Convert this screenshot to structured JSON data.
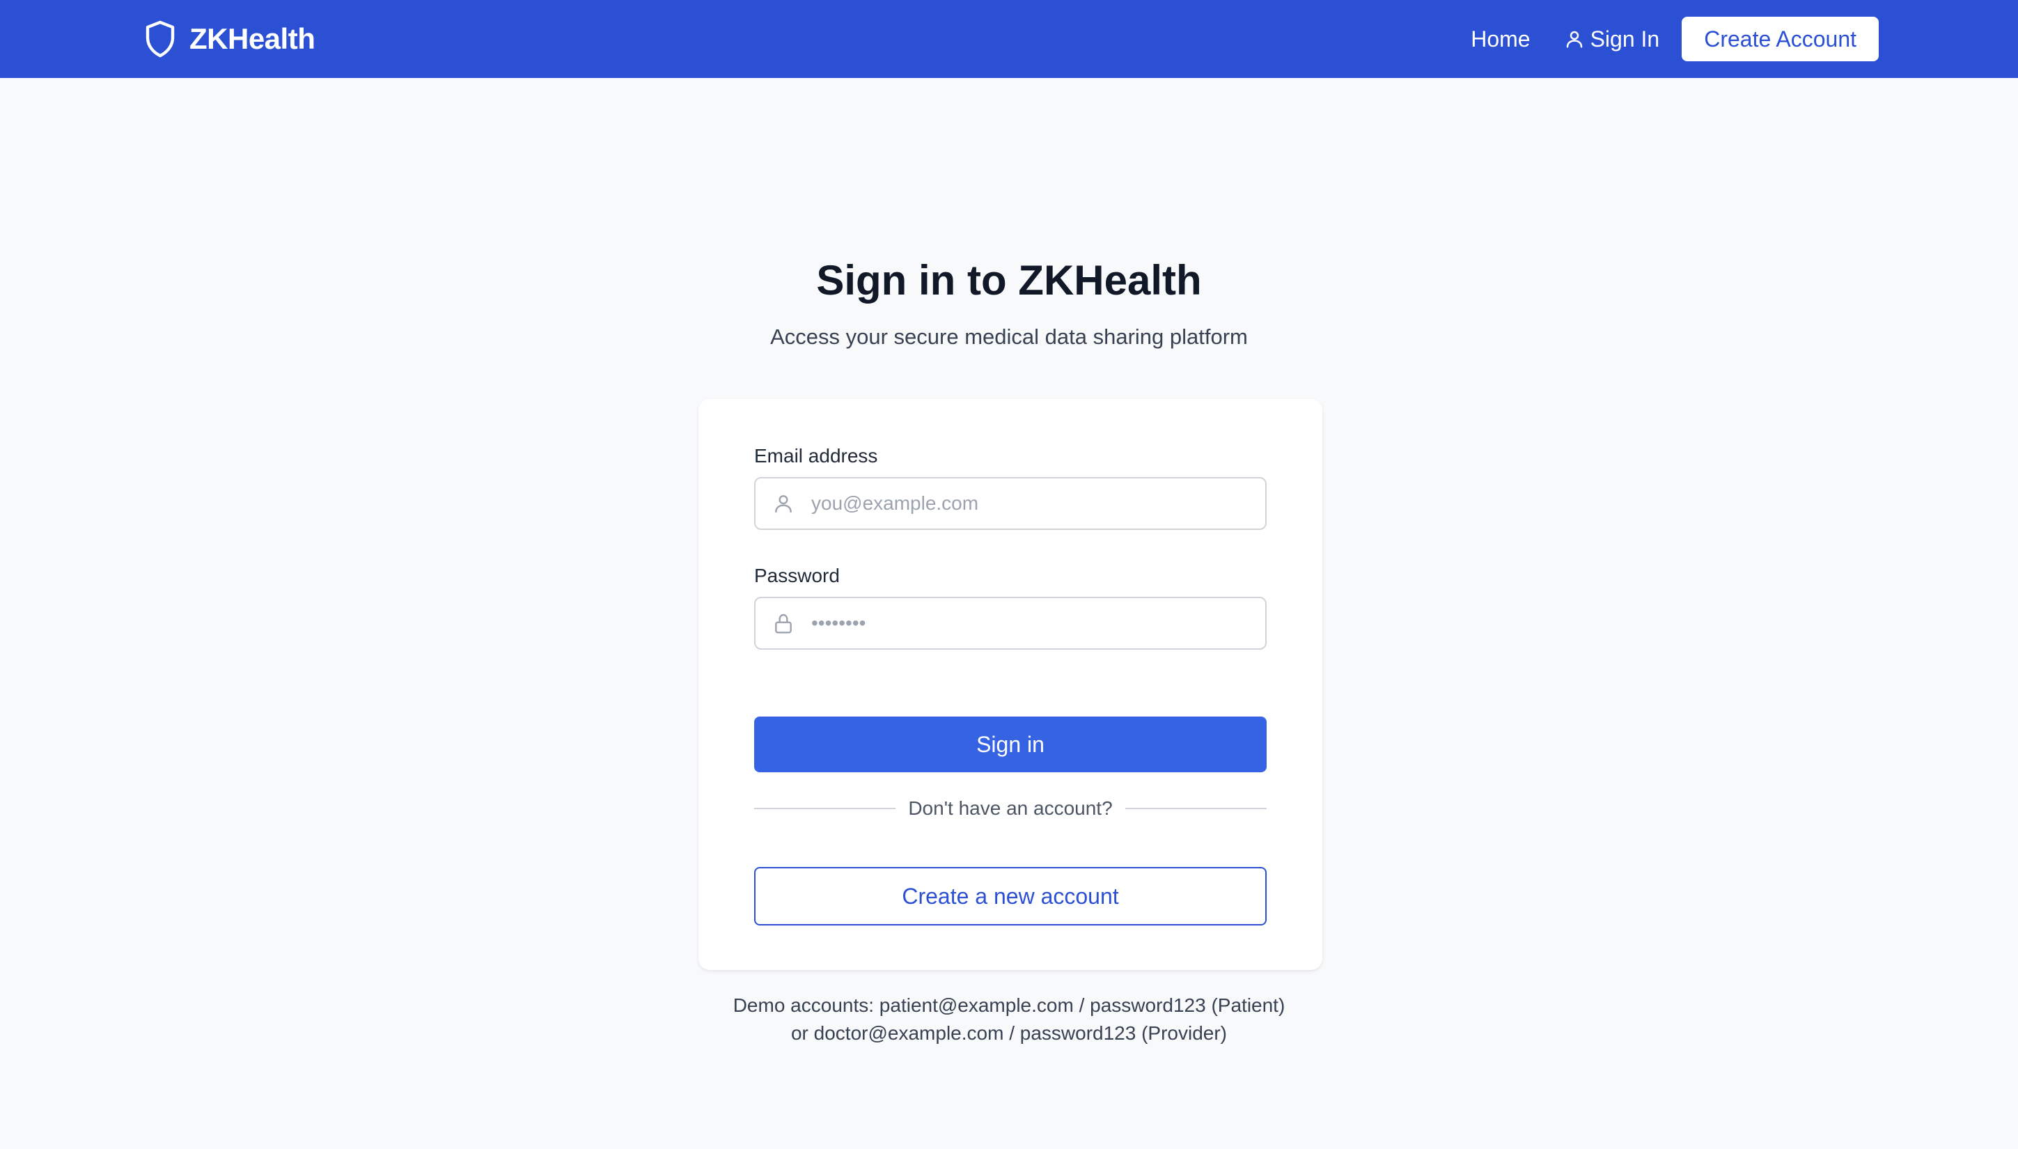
{
  "header": {
    "brand": "ZKHealth",
    "nav": {
      "home": "Home",
      "sign_in": "Sign In",
      "create_account": "Create Account"
    }
  },
  "main": {
    "title": "Sign in to ZKHealth",
    "subtitle": "Access your secure medical data sharing platform"
  },
  "form": {
    "email_label": "Email address",
    "email_placeholder": "you@example.com",
    "email_value": "",
    "password_label": "Password",
    "password_placeholder": "••••••••",
    "sign_in_button": "Sign in",
    "divider_text": "Don't have an account?",
    "create_button": "Create a new account"
  },
  "demo": {
    "line1": "Demo accounts: patient@example.com / password123 (Patient)",
    "line2": "or doctor@example.com / password123 (Provider)"
  },
  "colors": {
    "brand_blue": "#2b50d4",
    "primary_button": "#3563e3",
    "page_background": "#f8f9fb"
  },
  "icons": {
    "brand": "shield-icon",
    "nav_sign_in": "user-icon",
    "email_field": "user-icon",
    "password_field": "lock-icon"
  }
}
